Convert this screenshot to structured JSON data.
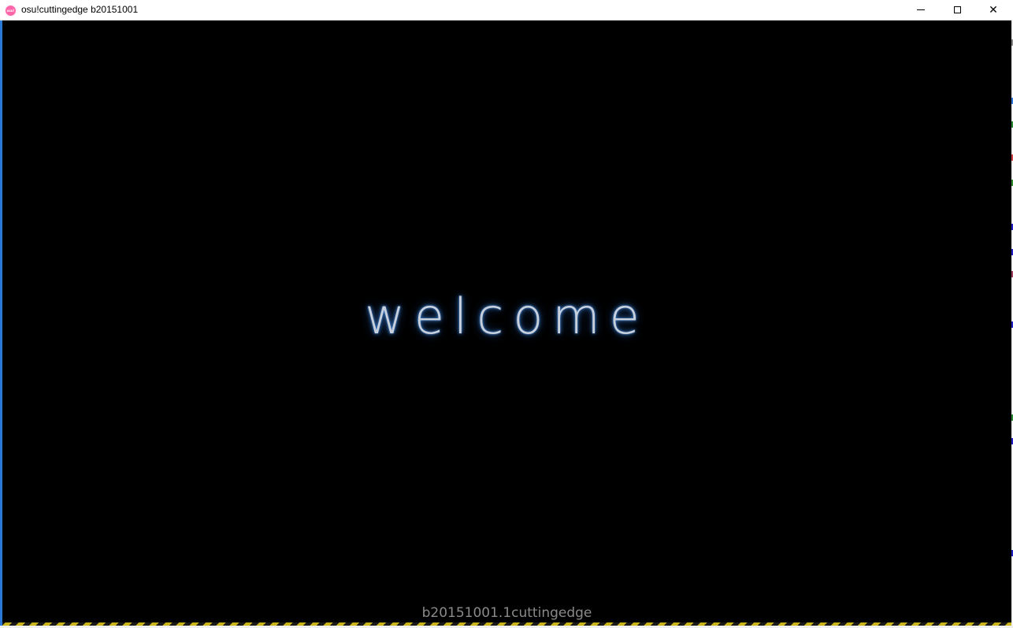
{
  "window": {
    "title": "osu!cuttingedge b20151001",
    "icon": "osu-logo-icon",
    "icon_text": "osu!",
    "accent_color": "#ff66aa",
    "controls": {
      "minimize": "minimize-icon",
      "maximize": "maximize-icon",
      "close": "close-icon",
      "close_glyph": "✕"
    }
  },
  "game": {
    "welcome_text": "welcome",
    "version_text": "b20151001.1cuttingedge",
    "background_color": "#000000",
    "glow_color": "#3a7fd0"
  }
}
